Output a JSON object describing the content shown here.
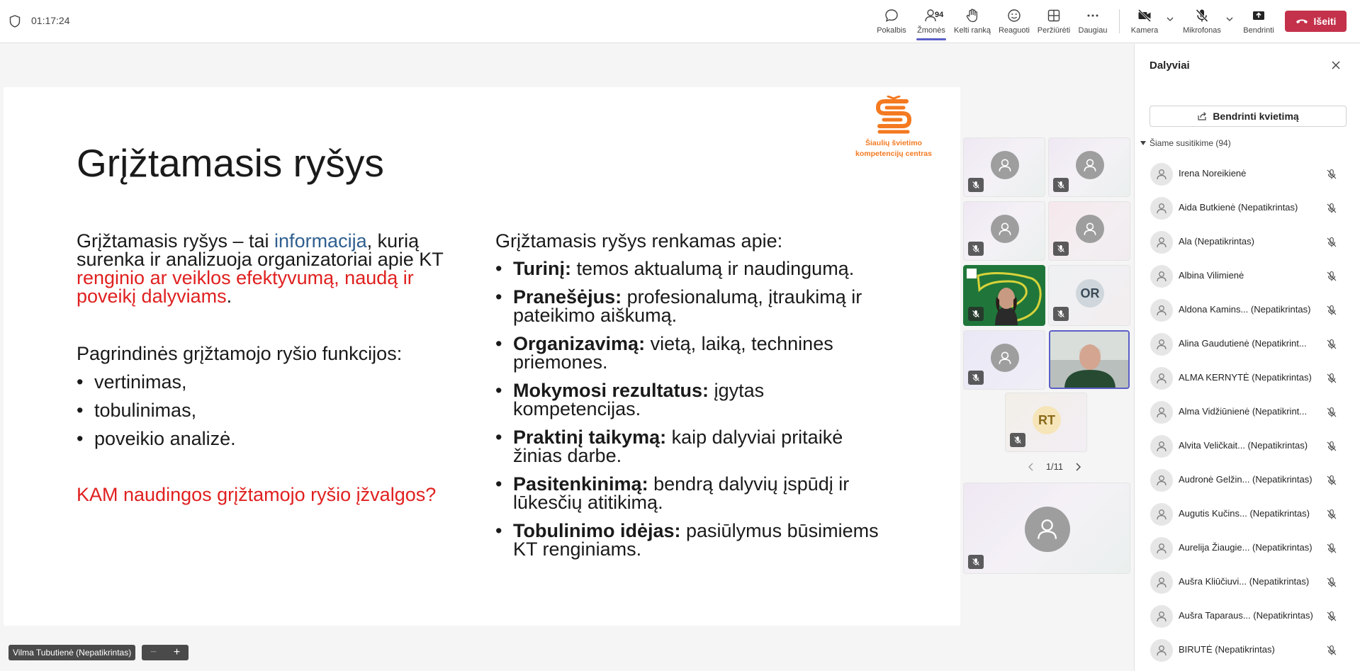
{
  "meeting": {
    "timer": "01:17:24"
  },
  "toolbar": {
    "chat_label": "Pokalbis",
    "people_label": "Žmonės",
    "people_count": "94",
    "raise_hand_label": "Kelti ranką",
    "react_label": "Reaguoti",
    "view_label": "Peržiūrėti",
    "more_label": "Daugiau",
    "camera_label": "Kamera",
    "mic_label": "Mikrofonas",
    "share_label": "Bendrinti",
    "leave_label": "Išeiti",
    "leave_color": "#c4314b",
    "active_tab": "people"
  },
  "slide": {
    "logo_line1": "Šiaulių švietimo",
    "logo_line2": "kompetencijų centras",
    "title": "Grįžtamasis ryšys",
    "intro_a": "Grįžtamasis ryšys – tai ",
    "intro_highlight": "informacija",
    "intro_b": ", kurią surenka ir analizuoja organizatoriai apie KT ",
    "intro_red": "renginio ar veiklos efektyvumą, naudą ir poveikį dalyviams",
    "intro_end": ".",
    "functions_heading": "Pagrindinės grįžtamojo ryšio funkcijos:",
    "functions": [
      "vertinimas,",
      "tobulinimas,",
      "poveikio analizė."
    ],
    "question": "KAM naudingos grįžtamojo ryšio įžvalgos?",
    "collected_heading": "Grįžtamasis ryšys renkamas apie:",
    "collected": [
      {
        "bold": "Turinį:",
        "text": " temos aktualumą ir naudingumą."
      },
      {
        "bold": "Pranešėjus:",
        "text": " profesionalumą, įtraukimą ir pateikimo aiškumą."
      },
      {
        "bold": "Organizavimą:",
        "text": " vietą, laiką, technines priemones."
      },
      {
        "bold": "Mokymosi rezultatus:",
        "text": " įgytas kompetencijas."
      },
      {
        "bold": "Praktinį taikymą:",
        "text": " kaip dalyviai pritaikė žinias darbe."
      },
      {
        "bold": "Pasitenkinimą:",
        "text": " bendrą dalyvių įspūdį ir lūkesčių atitikimą."
      },
      {
        "bold": "Tobulinimo idėjas:",
        "text": " pasiūlymus būsimiems KT renginiams."
      }
    ],
    "accent_blue": "#2f5f8f",
    "accent_red": "#e02020",
    "logo_color": "#f47920"
  },
  "gallery": {
    "tile_or_initials": "OR",
    "tile_rt_initials": "RT",
    "page_indicator": "1/11"
  },
  "stage": {
    "speaker_label": "Vilma Tubutienė (Nepatikrintas)",
    "zoom_minus": "−",
    "zoom_plus": "+"
  },
  "panel": {
    "title": "Dalyviai",
    "share_invite_label": "Bendrinti kvietimą",
    "section_label": "Šiame susitikime (94)",
    "participants": [
      {
        "name": "Irena Noreikienė"
      },
      {
        "name": "Aida Butkienė (Nepatikrintas)"
      },
      {
        "name": "Ala (Nepatikrintas)"
      },
      {
        "name": "Albina Vilimienė"
      },
      {
        "name": "Aldona Kamins...  (Nepatikrintas)"
      },
      {
        "name": "Alina Gaudutienė (Nepatikrint..."
      },
      {
        "name": "ALMA KERNYTĖ (Nepatikrintas)"
      },
      {
        "name": "Alma Vidžiūnienė (Nepatikrint..."
      },
      {
        "name": "Alvita Veličkait...  (Nepatikrintas)"
      },
      {
        "name": "Audronė Gelžin...  (Nepatikrintas)"
      },
      {
        "name": "Augutis Kučins...  (Nepatikrintas)"
      },
      {
        "name": "Aurelija Žiaugie...  (Nepatikrintas)"
      },
      {
        "name": "Aušra Kliūčiuvi...  (Nepatikrintas)"
      },
      {
        "name": "Aušra Taparaus...  (Nepatikrintas)"
      },
      {
        "name": "BIRUTĖ (Nepatikrintas)"
      }
    ]
  }
}
